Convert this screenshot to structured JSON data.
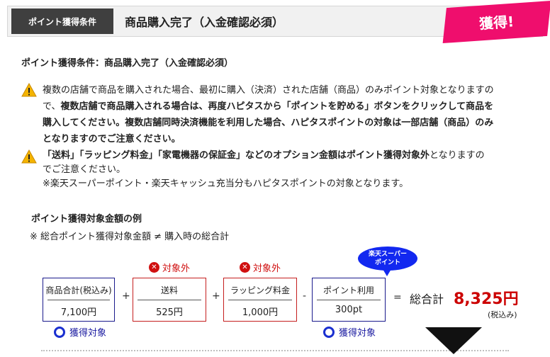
{
  "header": {
    "badge": "ポイント獲得条件",
    "title": "商品購入完了（入金確認必須）",
    "ribbon": "獲得!"
  },
  "condition": "ポイント獲得条件：商品購入完了（入金確認必須）",
  "notice1": {
    "line1": "複数の店舗で商品を購入された場合、最初に購入（決済）された店舗（商品）のみポイント対象となりますの",
    "line2a": "で、",
    "line2b": "複数店舗で商品購入される場合は、再度ハピタスから「ポイントを貯める」ボタンをクリックして商品を",
    "line3": "購入してください。複数店舗同時決済機能を利用した場合、ハピタスポイントの対象は一部店舗（商品）のみ",
    "line4": "となりますのでご注意ください。"
  },
  "notice2": {
    "line1b": "「送料」「ラッピング料金」「家電機器の保証金」などのオプション金額はポイント獲得対象外",
    "line1n": "となりますの",
    "line2": "でご注意ください。",
    "line3": "※楽天スーパーポイント・楽天キャッシュ充当分もハピタスポイントの対象となります。"
  },
  "example": {
    "title": "ポイント獲得対象金額の例",
    "note": "※ 総合ポイント獲得対象金額 ≠ 購入時の総合計"
  },
  "boxes": [
    {
      "label": "商品合計(税込み)",
      "value": "7,100円"
    },
    {
      "label": "送料",
      "value": "525円"
    },
    {
      "label": "ラッピング料金",
      "value": "1,000円"
    },
    {
      "label": "ポイント利用",
      "value": "300pt"
    }
  ],
  "operators": [
    "+",
    "+",
    "-",
    "="
  ],
  "excluded_label": "対象外",
  "target_label": "獲得対象",
  "bubble": {
    "line1": "楽天スーパー",
    "line2": "ポイント"
  },
  "total": {
    "label": "総合計",
    "value": "8,325円",
    "note": "(税込み)"
  },
  "colors": {
    "ribbon": "#ef0e6d",
    "excluded": "#d01010",
    "target": "#1a2fd0",
    "total": "#cc0000"
  }
}
